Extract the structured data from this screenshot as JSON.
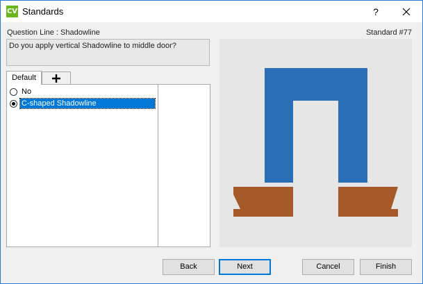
{
  "window": {
    "app_icon_text": "CV",
    "title": "Standards",
    "help_label": "?"
  },
  "header": {
    "question_line": "Question Line : Shadowline",
    "standard": "Standard #77"
  },
  "question": {
    "text": "Do you apply vertical Shadowline to middle door?"
  },
  "tabs": [
    {
      "label": "Default",
      "active": true
    },
    {
      "label": "+",
      "icon": "plus-icon"
    }
  ],
  "options": [
    {
      "label": "No",
      "checked": false
    },
    {
      "label": "C-shaped Shadowline",
      "checked": true,
      "selected": true
    }
  ],
  "preview": {
    "colors": {
      "shadowline": "#2a6fb5",
      "base": "#a65a29",
      "background": "#e6e6e6"
    }
  },
  "buttons": {
    "back": "Back",
    "next": "Next",
    "cancel": "Cancel",
    "finish": "Finish"
  }
}
